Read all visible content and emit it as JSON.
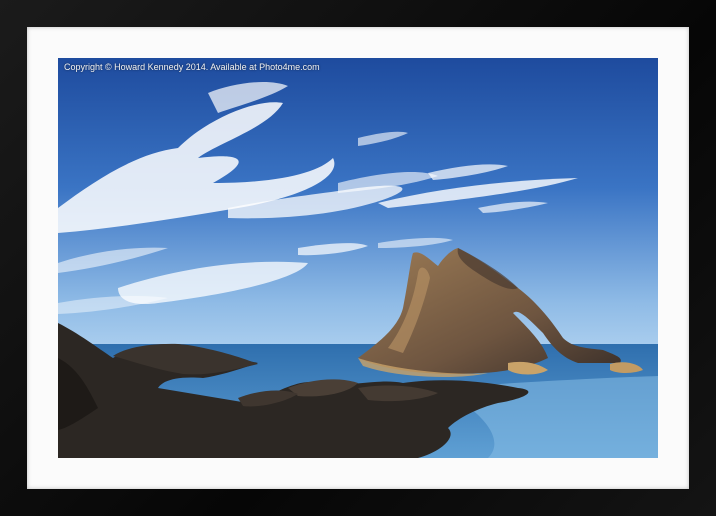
{
  "watermark": {
    "text": "Copyright © Howard Kennedy 2014. Available at Photo4me.com"
  },
  "colors": {
    "frame": "#0d0d0d",
    "mat": "#fbfbfb",
    "sky_top": "#1f4fa3",
    "sky_horizon": "#9cc3ea",
    "sea": "#3c82c0",
    "rock_lit": "#8a6d4c",
    "rock_dark": "#2b2622"
  },
  "scene": {
    "subject": "sea-arch-rock",
    "features": [
      "sky",
      "clouds",
      "sea",
      "sea-arch",
      "foreground-rocks"
    ]
  }
}
